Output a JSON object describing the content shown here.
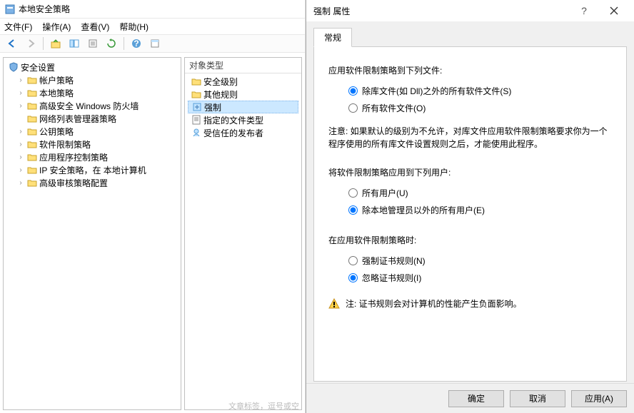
{
  "mmc": {
    "title": "本地安全策略",
    "menus": {
      "file": "文件(F)",
      "action": "操作(A)",
      "view": "查看(V)",
      "help": "帮助(H)"
    },
    "tree": {
      "root": "安全设置",
      "items": [
        "帐户策略",
        "本地策略",
        "高级安全 Windows 防火墙",
        "网络列表管理器策略",
        "公钥策略",
        "软件限制策略",
        "应用程序控制策略",
        "IP 安全策略，在 本地计算机",
        "高级审核策略配置"
      ]
    },
    "list": {
      "header": "对象类型",
      "items": [
        "安全级别",
        "其他规则",
        "强制",
        "指定的文件类型",
        "受信任的发布者"
      ],
      "selected_index": 2
    }
  },
  "dialog": {
    "title": "强制 属性",
    "tab": "常规",
    "section1": {
      "label": "应用软件限制策略到下列文件:",
      "opt1": "除库文件(如 Dll)之外的所有软件文件(S)",
      "opt2": "所有软件文件(O)"
    },
    "note1": "注意: 如果默认的级别为不允许，对库文件应用软件限制策略要求你为一个程序使用的所有库文件设置规则之后，才能使用此程序。",
    "section2": {
      "label": "将软件限制策略应用到下列用户:",
      "opt1": "所有用户(U)",
      "opt2": "除本地管理员以外的所有用户(E)"
    },
    "section3": {
      "label": "在应用软件限制策略时:",
      "opt1": "强制证书规则(N)",
      "opt2": "忽略证书规则(I)"
    },
    "warn": "注: 证书规则会对计算机的性能产生负面影响。",
    "buttons": {
      "ok": "确定",
      "cancel": "取消",
      "apply": "应用(A)"
    }
  },
  "footer_hint": "文章标签，逗号或空"
}
